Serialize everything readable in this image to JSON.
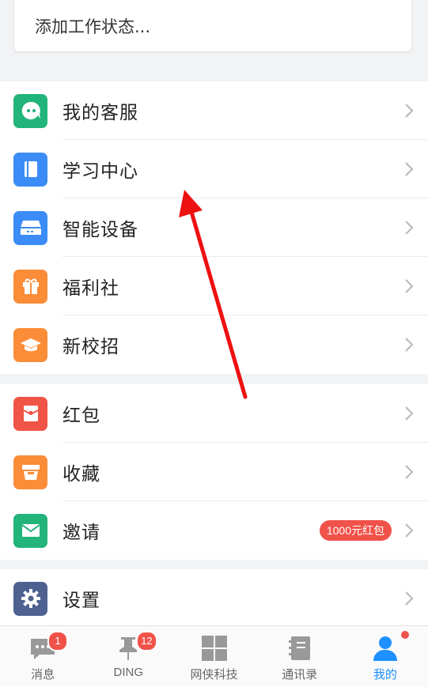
{
  "status": {
    "placeholder": "添加工作状态..."
  },
  "group1": [
    {
      "label": "我的客服",
      "icon": "customer-service-icon",
      "color": "#22b47a"
    },
    {
      "label": "学习中心",
      "icon": "book-icon",
      "color": "#3b8cf6"
    },
    {
      "label": "智能设备",
      "icon": "device-icon",
      "color": "#3b8cf6"
    },
    {
      "label": "福利社",
      "icon": "gift-icon",
      "color": "#fb8c38"
    },
    {
      "label": "新校招",
      "icon": "graduation-cap-icon",
      "color": "#fb8c38"
    }
  ],
  "group2": [
    {
      "label": "红包",
      "icon": "red-packet-icon",
      "color": "#ef5446"
    },
    {
      "label": "收藏",
      "icon": "favorites-box-icon",
      "color": "#fb8c38"
    },
    {
      "label": "邀请",
      "icon": "envelope-icon",
      "color": "#22b47a",
      "badge": "1000元红包"
    }
  ],
  "group3": [
    {
      "label": "设置",
      "icon": "gear-icon",
      "color": "#4e6191"
    }
  ],
  "tabs": [
    {
      "label": "消息",
      "icon": "chat-icon",
      "badge": "1"
    },
    {
      "label": "DING",
      "icon": "pin-icon",
      "badge": "12"
    },
    {
      "label": "网侠科技",
      "icon": "grid-icon"
    },
    {
      "label": "通讯录",
      "icon": "contacts-book-icon"
    },
    {
      "label": "我的",
      "icon": "person-icon",
      "active": true
    }
  ],
  "colors": {
    "accent": "#1e90ff",
    "badge": "#f0524a",
    "annotation_arrow": "#ee1111"
  }
}
